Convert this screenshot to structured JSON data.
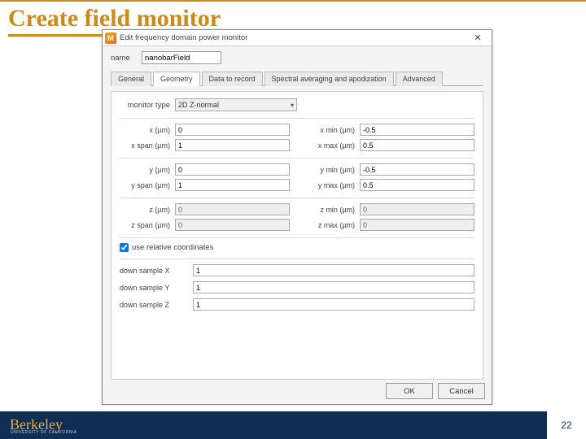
{
  "slide": {
    "title": "Create field monitor",
    "page_number": "22"
  },
  "logo": {
    "main": "Berkeley",
    "sub": "UNIVERSITY OF CALIFORNIA"
  },
  "dialog": {
    "title": "Edit frequency domain power monitor",
    "app_icon_letter": "M",
    "name_label": "name",
    "name_value": "nanobarField",
    "tabs": {
      "general": "General",
      "geometry": "Geometry",
      "data": "Data to record",
      "spectral": "Spectral averaging and apodization",
      "advanced": "Advanced"
    },
    "monitor_type_label": "monitor type",
    "monitor_type_value": "2D Z-normal",
    "fields": {
      "x_label": "x (µm)",
      "x_value": "0",
      "xspan_label": "x span (µm)",
      "xspan_value": "1",
      "xmin_label": "x min (µm)",
      "xmin_value": "-0.5",
      "xmax_label": "x max (µm)",
      "xmax_value": "0.5",
      "y_label": "y (µm)",
      "y_value": "0",
      "yspan_label": "y span (µm)",
      "yspan_value": "1",
      "ymin_label": "y min (µm)",
      "ymin_value": "-0.5",
      "ymax_label": "y max (µm)",
      "ymax_value": "0.5",
      "z_label": "z (µm)",
      "z_value": "0",
      "zspan_label": "z span (µm)",
      "zspan_value": "0",
      "zmin_label": "z min (µm)",
      "zmin_value": "0",
      "zmax_label": "z max (µm)",
      "zmax_value": "0"
    },
    "use_relative_label": "use relative coordinates",
    "downsample": {
      "x_label": "down sample X",
      "x_value": "1",
      "y_label": "down sample Y",
      "y_value": "1",
      "z_label": "down sample Z",
      "z_value": "1"
    },
    "buttons": {
      "ok": "OK",
      "cancel": "Cancel"
    }
  }
}
